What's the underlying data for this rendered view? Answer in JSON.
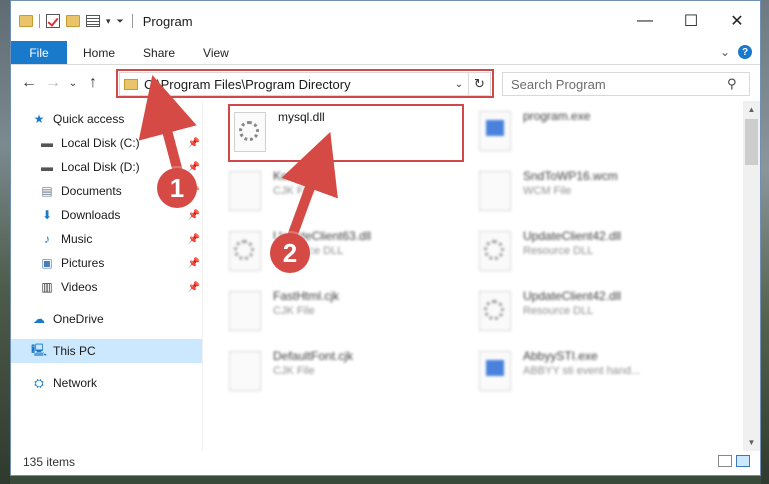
{
  "window": {
    "title": "Program",
    "minimize_glyph": "—",
    "maximize_glyph": "☐",
    "close_glyph": "✕"
  },
  "ribbon": {
    "tabs": [
      "File",
      "Home",
      "Share",
      "View"
    ],
    "help_glyph": "?"
  },
  "address": {
    "path": "C:\\Program Files\\Program Directory",
    "search_placeholder": "Search Program"
  },
  "nav": {
    "quick_access": "Quick access",
    "items": [
      {
        "label": "Local Disk (C:)",
        "icon": "drive-icon"
      },
      {
        "label": "Local Disk (D:)",
        "icon": "drive-icon"
      },
      {
        "label": "Documents",
        "icon": "documents-icon"
      },
      {
        "label": "Downloads",
        "icon": "downloads-icon"
      },
      {
        "label": "Music",
        "icon": "music-icon"
      },
      {
        "label": "Pictures",
        "icon": "pictures-icon"
      },
      {
        "label": "Videos",
        "icon": "videos-icon"
      }
    ],
    "onedrive": "OneDrive",
    "this_pc": "This PC",
    "network": "Network"
  },
  "files": [
    {
      "name": "mysql.dll",
      "type": "",
      "selected": true
    },
    {
      "name": "program.exe",
      "type": ""
    },
    {
      "name": "Koovijk.cjk",
      "type": "CJK File"
    },
    {
      "name": "SndToWP16.wcm",
      "type": "WCM File"
    },
    {
      "name": "UpdateClient63.dll",
      "type": "Resource DLL"
    },
    {
      "name": "UpdateClient42.dll",
      "type": "Resource DLL"
    },
    {
      "name": "FastHtml.cjk",
      "type": "CJK File"
    },
    {
      "name": "UpdateClient42.dll",
      "type": "Resource DLL"
    },
    {
      "name": "DefaultFont.cjk",
      "type": "CJK File"
    },
    {
      "name": "AbbyySTI.exe",
      "type": "ABBYY sti event hand..."
    }
  ],
  "status": {
    "count": "135 items"
  },
  "callouts": [
    "1",
    "2"
  ],
  "colors": {
    "accent": "#1979ca",
    "highlight": "#d04848",
    "selection": "#cce8ff"
  }
}
